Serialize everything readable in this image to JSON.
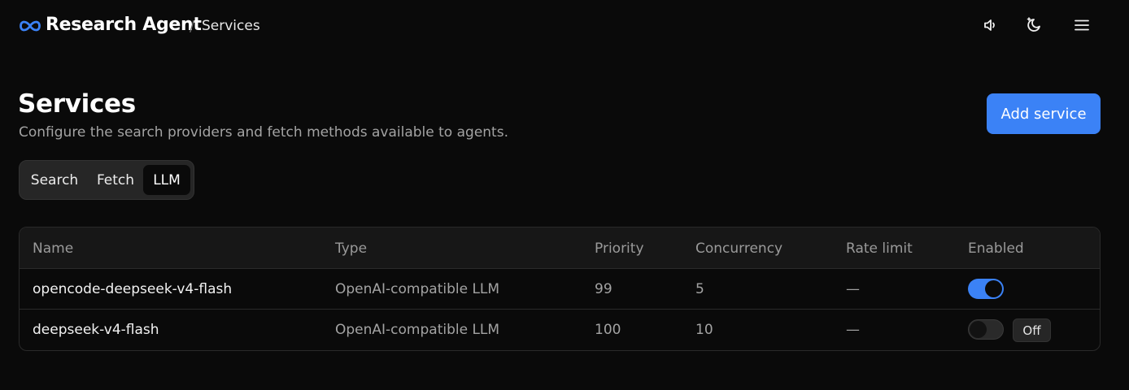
{
  "header": {
    "brand": "Research Agent",
    "separator": "/",
    "breadcrumb": "Services",
    "colors": {
      "logo": "#3b82f6"
    },
    "icons": [
      "infinity-logo-icon",
      "volume-icon",
      "theme-toggle-icon",
      "hamburger-menu-icon"
    ]
  },
  "page": {
    "title": "Services",
    "subtitle": "Configure the search providers and fetch methods available to agents.",
    "add_button": "Add service"
  },
  "tabs": [
    {
      "label": "Search",
      "active": false
    },
    {
      "label": "Fetch",
      "active": false
    },
    {
      "label": "LLM",
      "active": true
    }
  ],
  "table": {
    "columns": [
      "Name",
      "Type",
      "Priority",
      "Concurrency",
      "Rate limit",
      "Enabled"
    ],
    "rows": [
      {
        "name": "opencode-deepseek-v4-flash",
        "type": "OpenAI-compatible LLM",
        "priority": "99",
        "concurrency": "5",
        "rate_limit": "—",
        "enabled": true,
        "status_label": ""
      },
      {
        "name": "deepseek-v4-flash",
        "type": "OpenAI-compatible LLM",
        "priority": "100",
        "concurrency": "10",
        "rate_limit": "—",
        "enabled": false,
        "status_label": "Off"
      }
    ]
  },
  "colors": {
    "accent": "#3b82f6",
    "background": "#0a0a0a"
  }
}
